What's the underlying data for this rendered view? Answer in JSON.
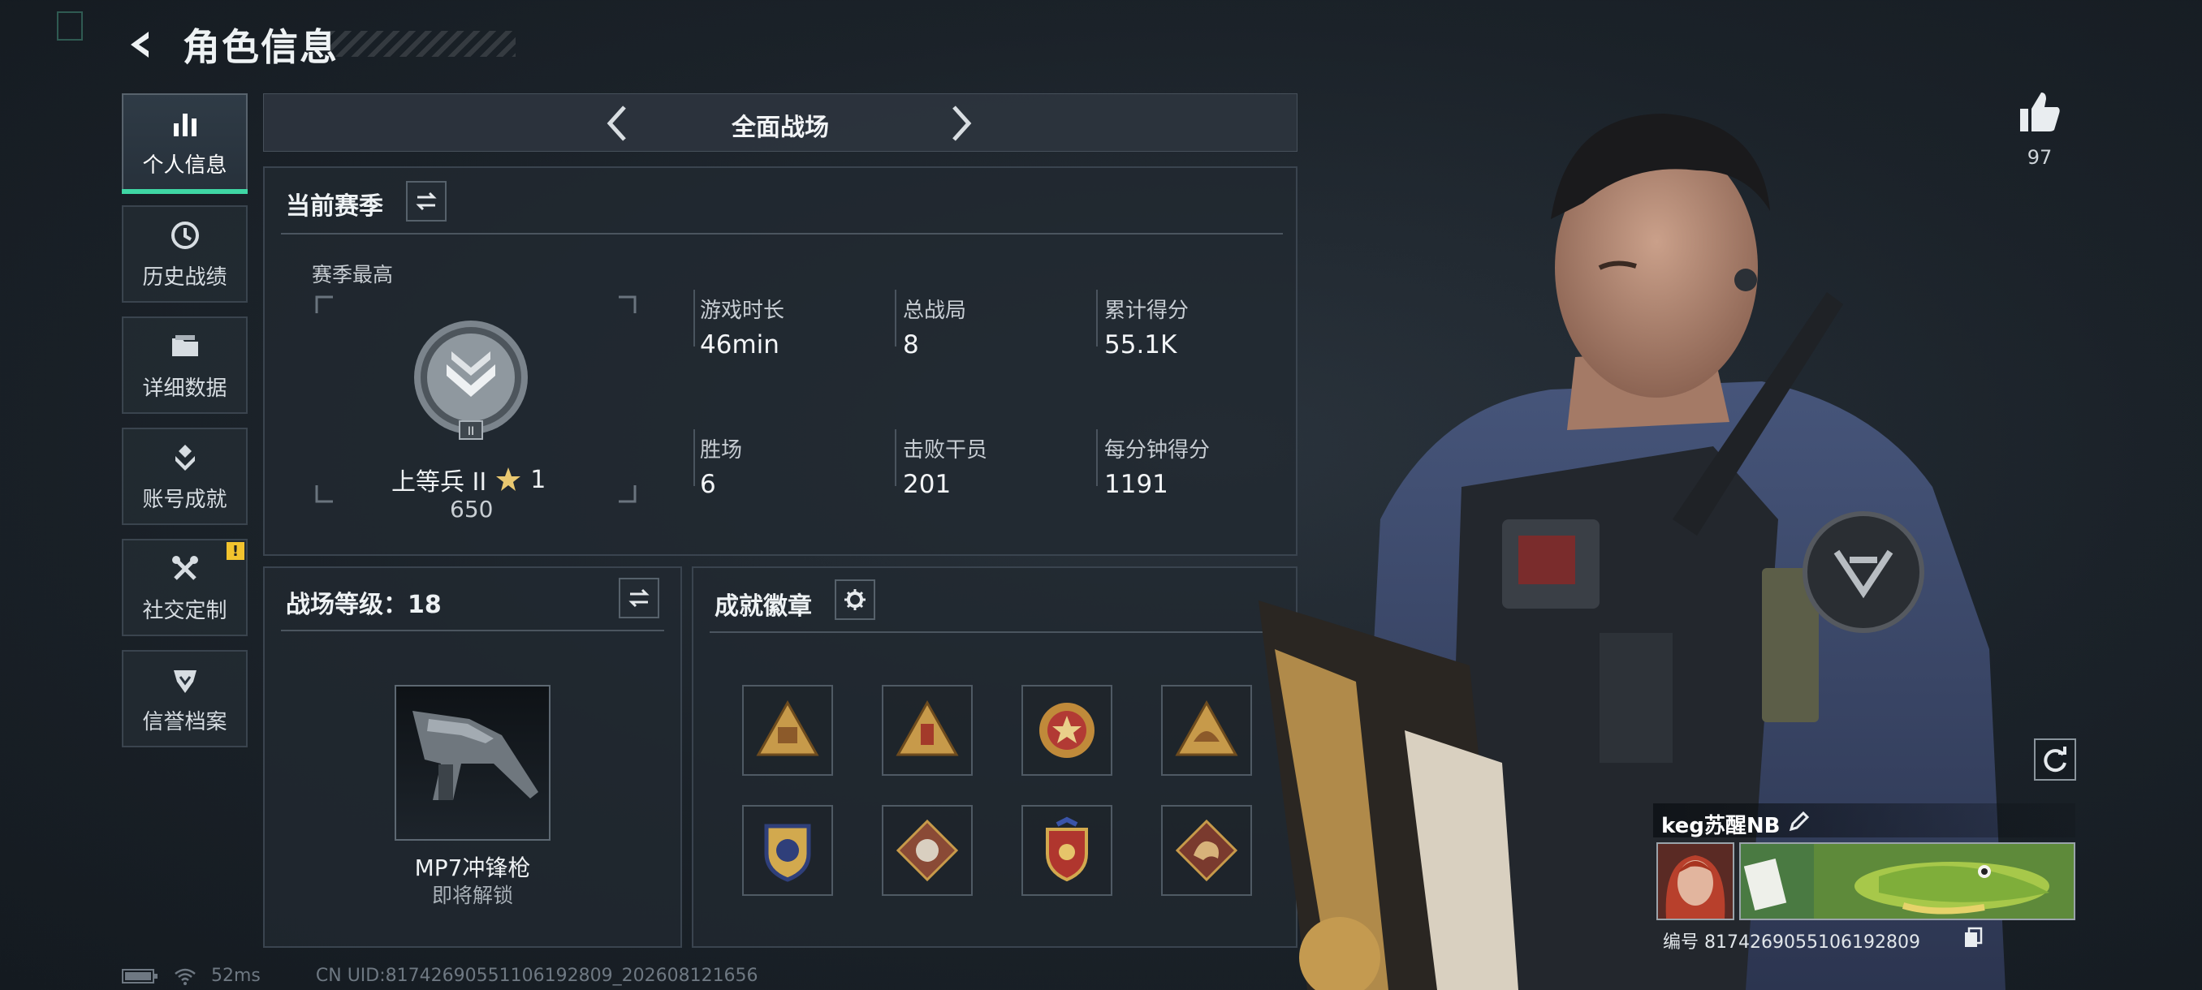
{
  "header": {
    "title": "角色信息"
  },
  "nav": [
    {
      "label": "个人信息",
      "icon": "bar-chart-icon",
      "active": true
    },
    {
      "label": "历史战绩",
      "icon": "history-icon"
    },
    {
      "label": "详细数据",
      "icon": "folder-icon"
    },
    {
      "label": "账号成就",
      "icon": "achievement-icon"
    },
    {
      "label": "社交定制",
      "icon": "wrench-icon",
      "badge": "!"
    },
    {
      "label": "信誉档案",
      "icon": "credit-icon"
    }
  ],
  "mode": {
    "name": "全面战场"
  },
  "season": {
    "title": "当前赛季",
    "best_label": "赛季最高",
    "rank_name": "上等兵 II",
    "rank_stars": "1",
    "rank_points": "650",
    "stats": [
      {
        "label": "游戏时长",
        "value": "46min"
      },
      {
        "label": "总战局",
        "value": "8"
      },
      {
        "label": "累计得分",
        "value": "55.1K"
      },
      {
        "label": "胜场",
        "value": "6"
      },
      {
        "label": "击败干员",
        "value": "201"
      },
      {
        "label": "每分钟得分",
        "value": "1191"
      }
    ]
  },
  "level": {
    "title": "战场等级：18",
    "weapon_name": "MP7冲锋枪",
    "weapon_status": "即将解锁"
  },
  "badges": {
    "title": "成就徽章",
    "count": 8
  },
  "profile": {
    "likes": "97",
    "name": "keg苏醒NB",
    "id": "编号 817426905510619280​9"
  },
  "status": {
    "ping": "52ms",
    "uid": "CN UID:8174269055110619280​9_202608121656"
  },
  "colors": {
    "accent": "#3fd6a4",
    "alert": "#f2c32e"
  }
}
